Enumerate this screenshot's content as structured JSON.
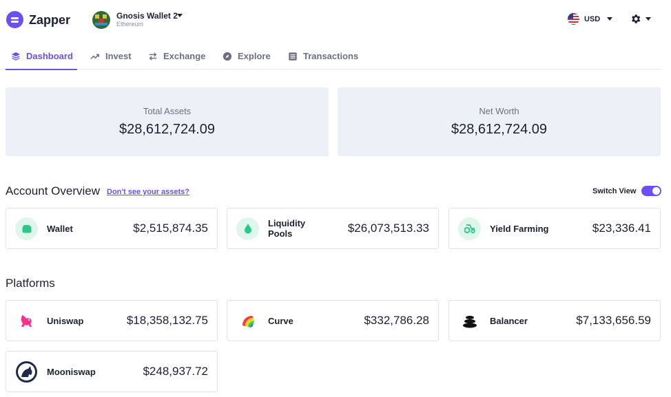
{
  "header": {
    "brand": "Zapper",
    "wallet": {
      "name": "Gnosis Wallet 2",
      "network": "Ethereum"
    },
    "currency": "USD",
    "icons": {
      "logo": "zapper-logo-icon",
      "settings": "gear-icon",
      "flag": "us-flag-icon"
    }
  },
  "tabs": [
    {
      "label": "Dashboard",
      "icon": "layers-icon",
      "active": true
    },
    {
      "label": "Invest",
      "icon": "trend-icon",
      "active": false
    },
    {
      "label": "Exchange",
      "icon": "swap-arrows-icon",
      "active": false
    },
    {
      "label": "Explore",
      "icon": "compass-icon",
      "active": false
    },
    {
      "label": "Transactions",
      "icon": "list-icon",
      "active": false
    }
  ],
  "summary": {
    "total_assets": {
      "label": "Total Assets",
      "value": "$28,612,724.09"
    },
    "net_worth": {
      "label": "Net Worth",
      "value": "$28,612,724.09"
    }
  },
  "account_overview": {
    "title": "Account Overview",
    "help_link": "Don't see your assets?",
    "switch_view_label": "Switch View",
    "switch_view_on": true,
    "items": [
      {
        "name": "Wallet",
        "amount": "$2,515,874.35",
        "icon": "wallet-icon"
      },
      {
        "name": "Liquidity Pools",
        "amount": "$26,073,513.33",
        "icon": "droplet-icon"
      },
      {
        "name": "Yield Farming",
        "amount": "$23,336.41",
        "icon": "tractor-icon"
      }
    ]
  },
  "platforms": {
    "title": "Platforms",
    "items": [
      {
        "name": "Uniswap",
        "amount": "$18,358,132.75",
        "icon": "uniswap-unicorn-icon"
      },
      {
        "name": "Curve",
        "amount": "$332,786.28",
        "icon": "curve-rainbow-icon"
      },
      {
        "name": "Balancer",
        "amount": "$7,133,656.59",
        "icon": "balancer-stack-icon"
      },
      {
        "name": "Mooniswap",
        "amount": "$248,937.72",
        "icon": "mooniswap-unicorn-icon"
      }
    ]
  },
  "colors": {
    "accent": "#6b4ef5",
    "mint": "#dff6ec",
    "summary_bg": "#edf0f6"
  }
}
